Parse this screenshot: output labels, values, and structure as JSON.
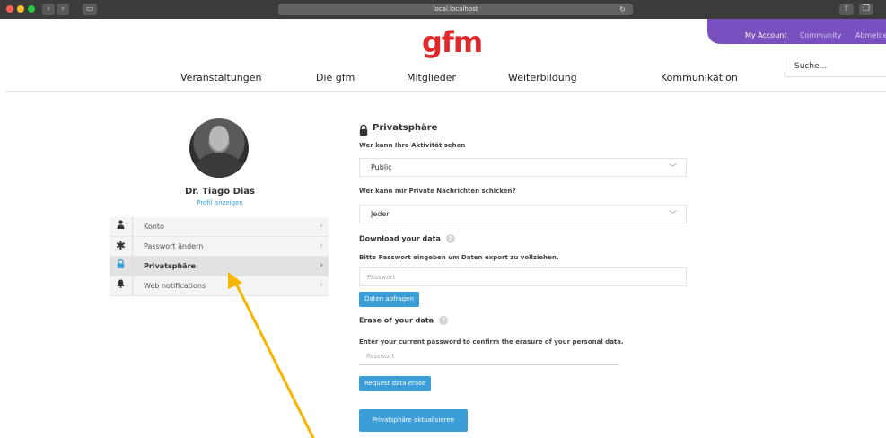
{
  "browser": {
    "url": "local.localhost",
    "colors": {
      "close": "#ff5f57",
      "minimize": "#febc2e",
      "maximize": "#28c840"
    }
  },
  "account_bar": {
    "my_account": "My Account",
    "community": "Community",
    "logout": "Abmelde",
    "color": "#7a4fbf"
  },
  "logo": {
    "text": "gfm",
    "color": "#e1282c"
  },
  "nav": {
    "items": [
      "Veranstaltungen",
      "Die gfm",
      "Mitglieder",
      "Weiterbildung",
      "Kommunikation"
    ],
    "search_placeholder": "Suche..."
  },
  "profile": {
    "name": "Dr. Tiago Dias",
    "link": "Profil anzeigen"
  },
  "menu": {
    "items": [
      {
        "label": "Konto",
        "icon": "user-icon",
        "active": false
      },
      {
        "label": "Passwort ändern",
        "icon": "asterisk-icon",
        "active": false
      },
      {
        "label": "Privatsphäre",
        "icon": "lock-icon",
        "active": true
      },
      {
        "label": "Web notifications",
        "icon": "bell-icon",
        "active": false
      }
    ]
  },
  "privacy": {
    "title": "Privatsphäre",
    "activity_question": "Wer kann Ihre Aktivität sehen",
    "activity_value": "Public",
    "messages_question": "Wer kann mir Private Nachrichten schicken?",
    "messages_value": "Jeder",
    "download_heading": "Download your data",
    "download_instruction": "Bitte Passwort eingeben um Daten export zu vollziehen.",
    "download_placeholder": "Passwort",
    "download_button": "Daten abfragen",
    "erase_heading": "Erase of your data",
    "erase_instruction": "Enter your current password to confirm the erasure of your personal data.",
    "erase_placeholder": "Passwort",
    "erase_button": "Request data erase",
    "submit_button": "Privatsphäre aktualisieren",
    "accent": "#3b9ed8"
  },
  "annotation": {
    "color": "#f7b500"
  }
}
